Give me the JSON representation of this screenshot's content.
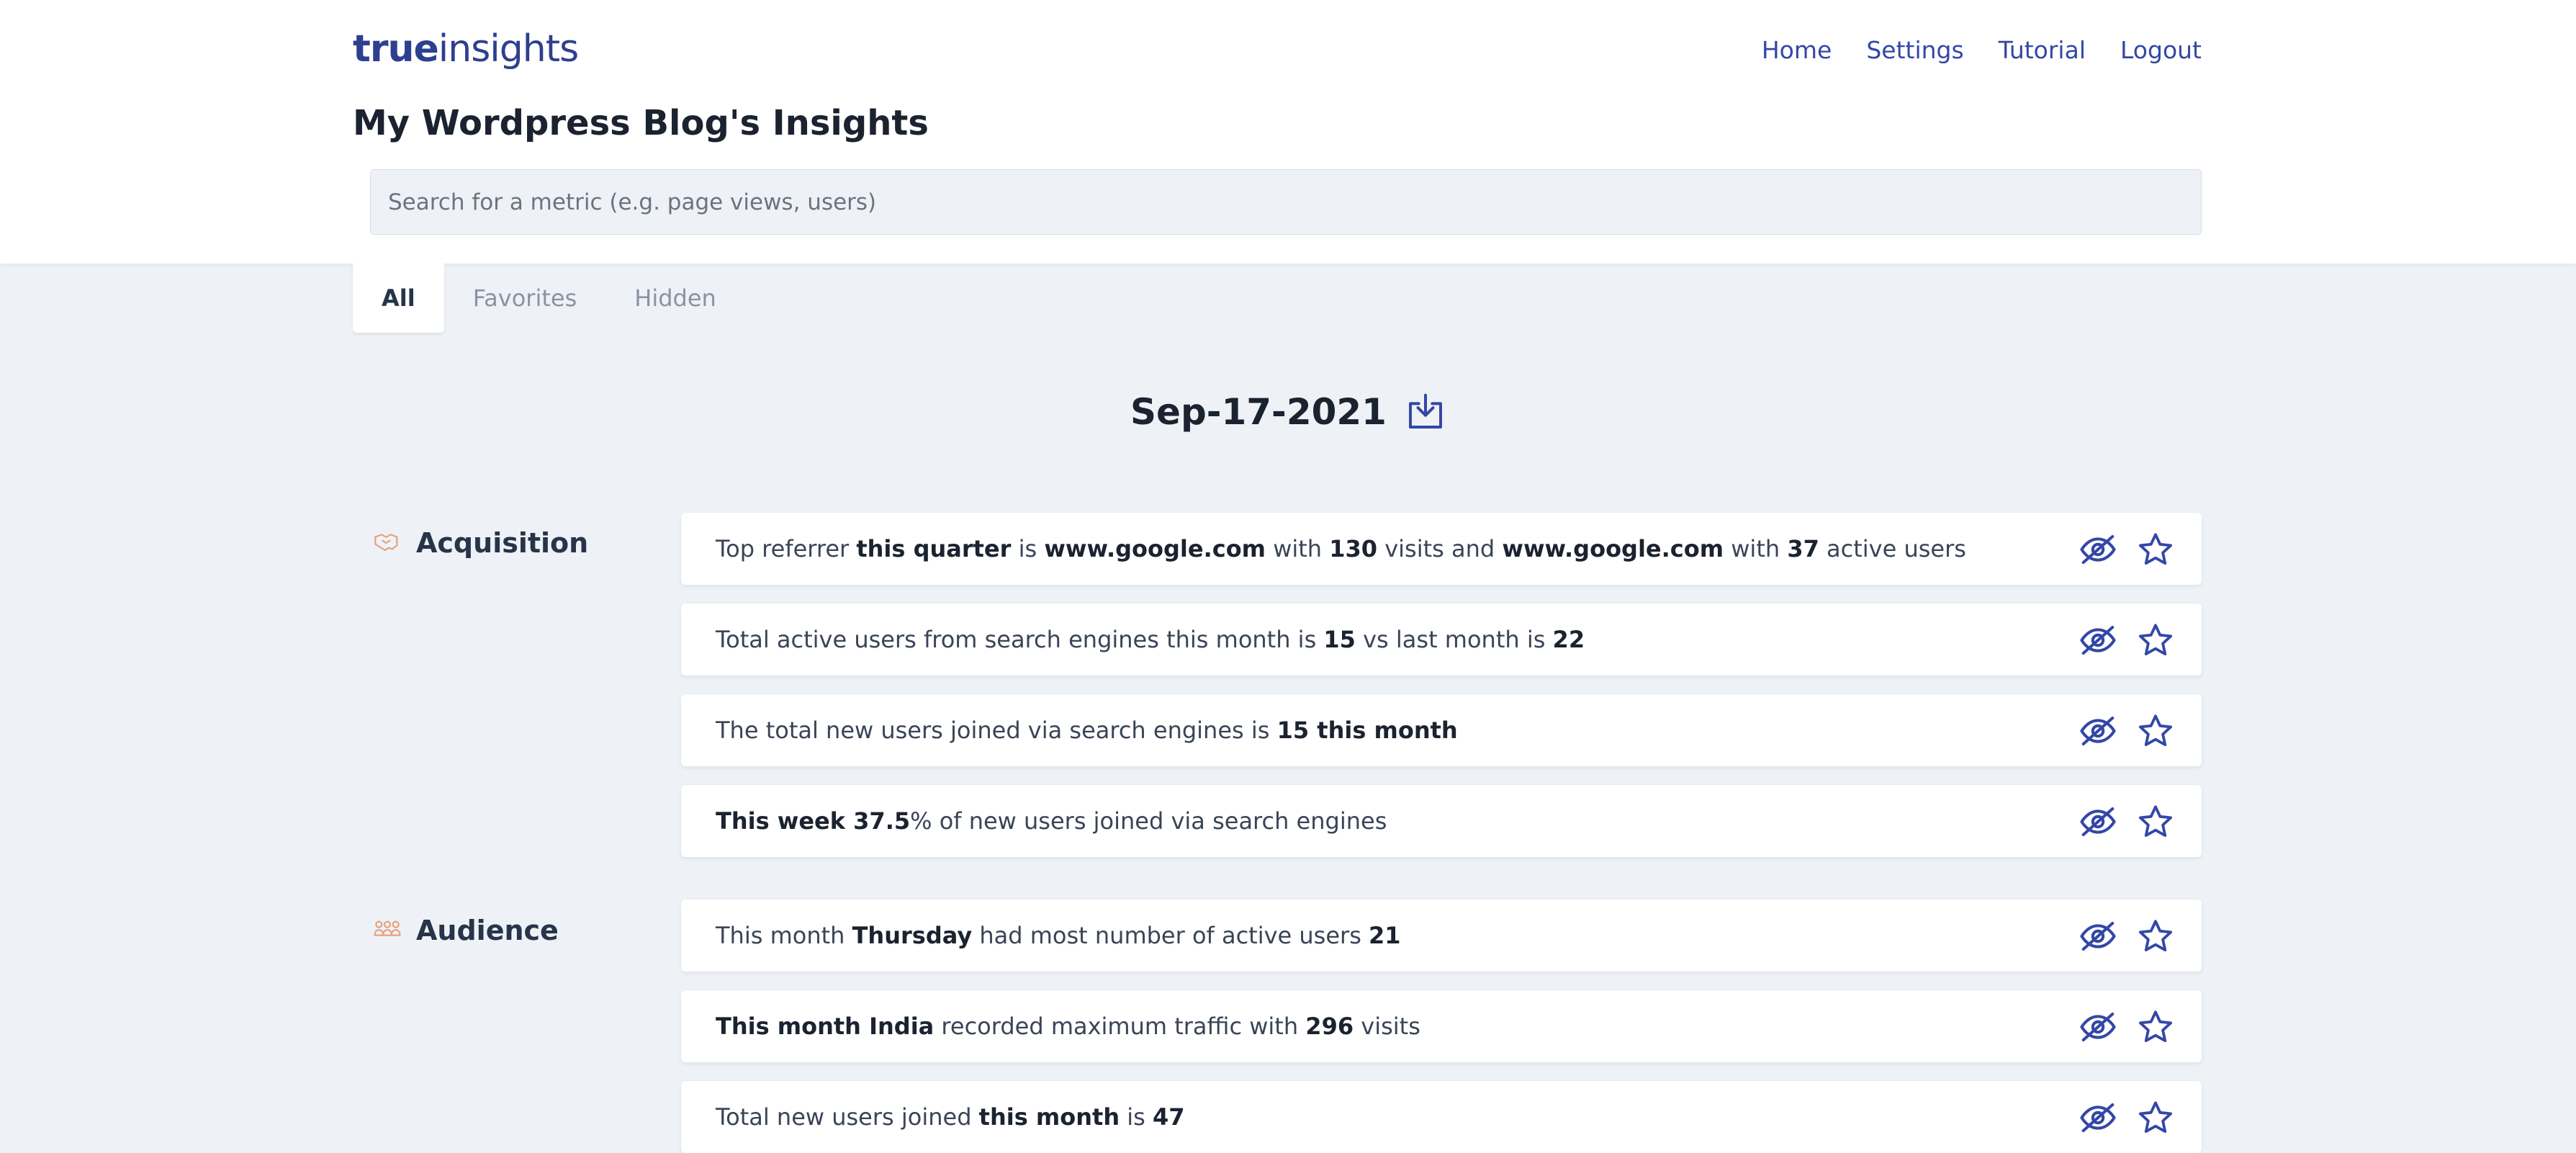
{
  "header": {
    "logo_bold": "true",
    "logo_light": "insights",
    "nav": [
      {
        "label": "Home"
      },
      {
        "label": "Settings"
      },
      {
        "label": "Tutorial"
      },
      {
        "label": "Logout"
      }
    ],
    "page_title": "My Wordpress Blog's Insights",
    "search_placeholder": "Search for a metric (e.g. page views, users)"
  },
  "tabs": [
    {
      "label": "All",
      "active": true
    },
    {
      "label": "Favorites",
      "active": false
    },
    {
      "label": "Hidden",
      "active": false
    }
  ],
  "report": {
    "date": "Sep-17-2021",
    "download_icon": "download-icon"
  },
  "colors": {
    "accent": "#3347a6",
    "section_icon": "#e8a07a",
    "background": "#eef2f7"
  },
  "sections": [
    {
      "title": "Acquisition",
      "icon": "handshake-icon",
      "insights": [
        {
          "parts": [
            {
              "t": "Top referrer "
            },
            {
              "t": "this quarter",
              "b": true
            },
            {
              "t": " is "
            },
            {
              "t": "www.google.com",
              "b": true
            },
            {
              "t": " with "
            },
            {
              "t": "130",
              "b": true
            },
            {
              "t": " visits and "
            },
            {
              "t": "www.google.com",
              "b": true
            },
            {
              "t": " with "
            },
            {
              "t": "37",
              "b": true
            },
            {
              "t": " active users"
            }
          ]
        },
        {
          "parts": [
            {
              "t": "Total active users from search engines this month is "
            },
            {
              "t": "15",
              "b": true
            },
            {
              "t": " vs last month is "
            },
            {
              "t": "22",
              "b": true
            }
          ]
        },
        {
          "parts": [
            {
              "t": "The total new users joined via search engines is "
            },
            {
              "t": "15 this month",
              "b": true
            }
          ]
        },
        {
          "parts": [
            {
              "t": "This week 37.5",
              "b": true
            },
            {
              "t": "% of new users joined via search engines"
            }
          ]
        }
      ]
    },
    {
      "title": "Audience",
      "icon": "users-group-icon",
      "insights": [
        {
          "parts": [
            {
              "t": "This month "
            },
            {
              "t": "Thursday",
              "b": true
            },
            {
              "t": " had most number of active users "
            },
            {
              "t": "21",
              "b": true
            }
          ]
        },
        {
          "parts": [
            {
              "t": "This month India",
              "b": true
            },
            {
              "t": " recorded maximum traffic with "
            },
            {
              "t": "296",
              "b": true
            },
            {
              "t": " visits"
            }
          ]
        },
        {
          "parts": [
            {
              "t": "Total new users joined "
            },
            {
              "t": "this month",
              "b": true
            },
            {
              "t": " is "
            },
            {
              "t": "47",
              "b": true
            }
          ]
        }
      ]
    }
  ]
}
